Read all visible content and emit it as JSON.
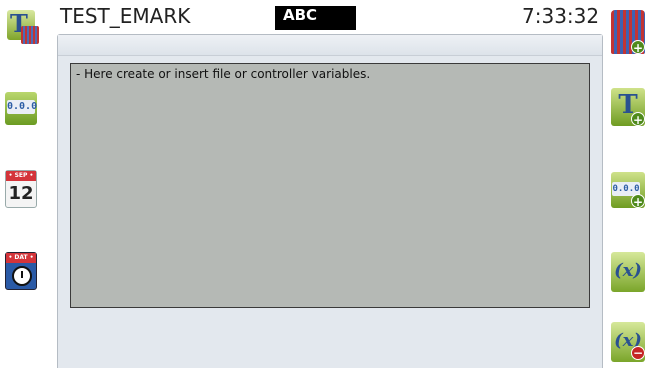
{
  "header": {
    "title": "TEST_EMARK",
    "mode": "ABC",
    "time": "7:33:32"
  },
  "editor": {
    "text": "- Here create or insert file or controller variables."
  },
  "left_toolbar": {
    "items": [
      {
        "name": "text-variable-icon",
        "glyph": "T"
      },
      {
        "name": "number-format-icon",
        "glyph": "0.0.0"
      },
      {
        "name": "date-icon",
        "header": "• SEP •",
        "glyph": "12"
      },
      {
        "name": "time-icon",
        "header": "• DAT •"
      }
    ]
  },
  "right_toolbar": {
    "items": [
      {
        "name": "add-variable-icon"
      },
      {
        "name": "add-text-icon",
        "glyph": "T"
      },
      {
        "name": "add-number-icon",
        "glyph": "0.0.0"
      },
      {
        "name": "function-icon",
        "glyph": "(x)"
      },
      {
        "name": "remove-function-icon",
        "glyph": "(x)"
      }
    ]
  },
  "colors": {
    "editor_bg": "#b5b9b5",
    "panel_bg": "#e3e8ee",
    "mode_bg": "#000000",
    "icon_green": "#7fa42a"
  }
}
